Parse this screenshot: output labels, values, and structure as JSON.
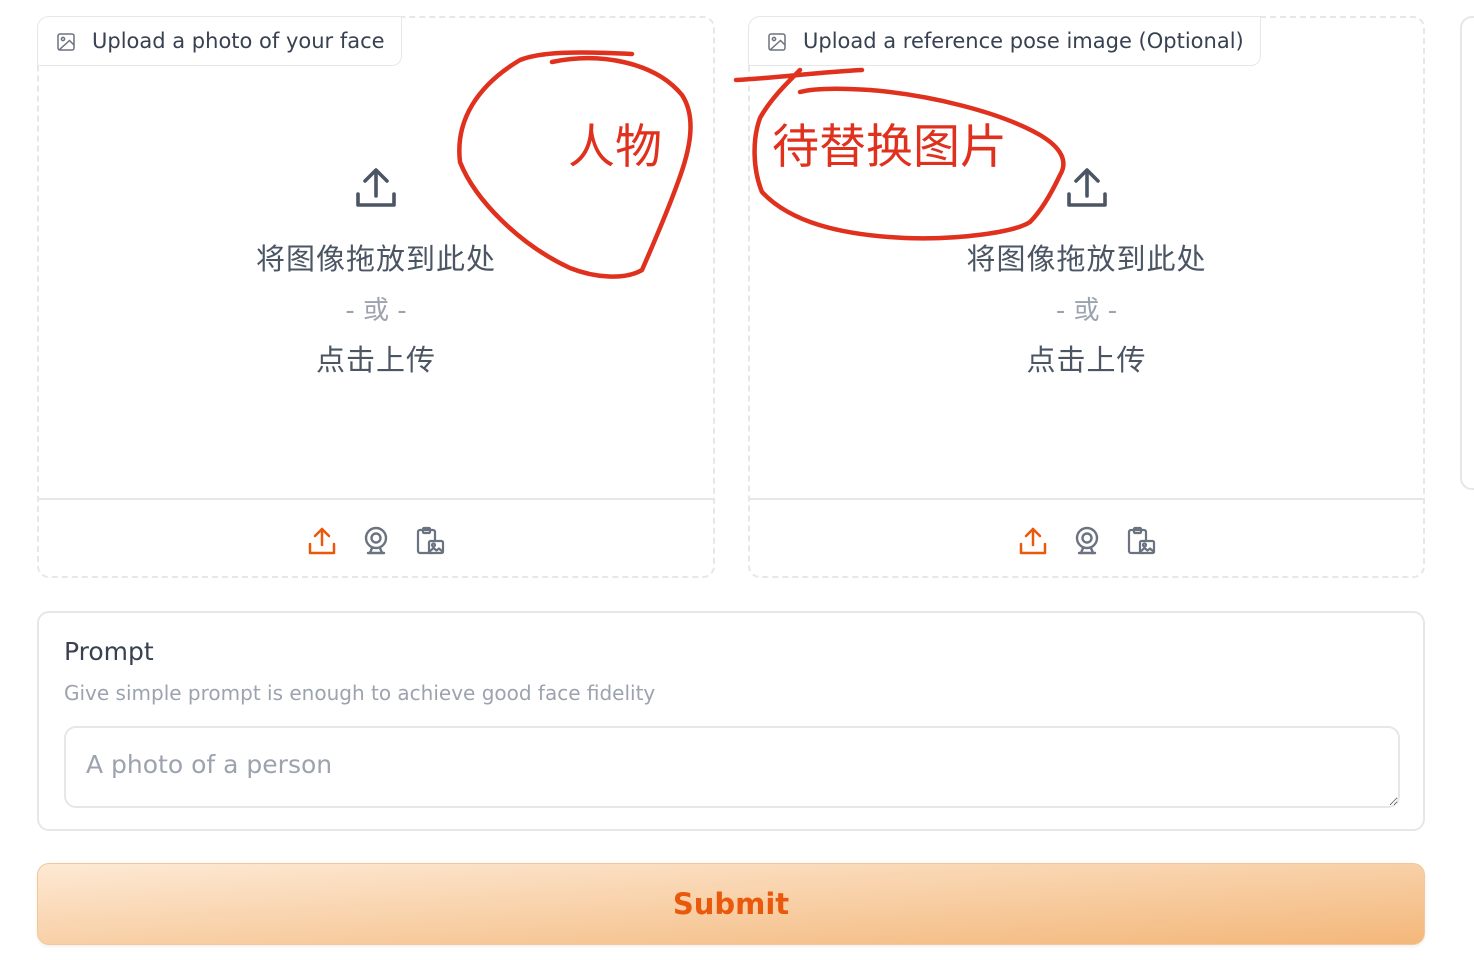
{
  "face_panel": {
    "label": "Upload a photo of your face",
    "drop_text": "将图像拖放到此处",
    "or_text": "- 或 -",
    "click_text": "点击上传"
  },
  "pose_panel": {
    "label": "Upload a reference pose image (Optional)",
    "drop_text": "将图像拖放到此处",
    "or_text": "- 或 -",
    "click_text": "点击上传"
  },
  "prompt": {
    "label": "Prompt",
    "info": "Give simple prompt is enough to achieve good face fidelity",
    "placeholder": "A photo of a person",
    "value": ""
  },
  "submit": {
    "label": "Submit"
  },
  "annotations": {
    "face_note": "人物",
    "pose_note": "待替换图片"
  },
  "colors": {
    "accent": "#ea580c",
    "annotation": "#e0301e",
    "border": "#e5e7eb",
    "icon_gray": "#6b7280"
  },
  "icons": {
    "panel_label": "image-icon",
    "dropzone": "upload-icon",
    "toolbar": [
      "upload-icon",
      "webcam-icon",
      "clipboard-icon"
    ]
  }
}
